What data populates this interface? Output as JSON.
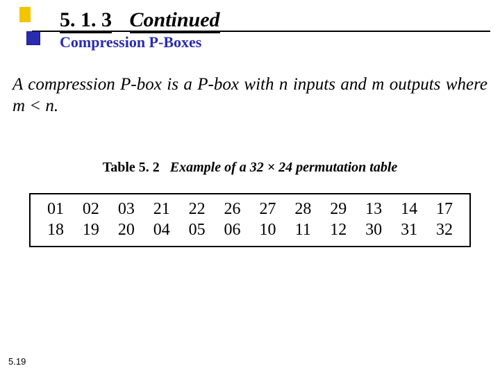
{
  "header": {
    "section_number": "5. 1. 3",
    "continued_label": "Continued",
    "subtitle": "Compression P-Boxes"
  },
  "body": {
    "text": "A compression P-box is a P-box with n inputs and m outputs where m < n."
  },
  "caption": {
    "prefix": "Table  5. 2",
    "desc": "Example of a 32 × 24 permutation table"
  },
  "chart_data": {
    "type": "table",
    "title": "Example of a 32 × 24 permutation table",
    "rows": [
      [
        "01",
        "02",
        "03",
        "21",
        "22",
        "26",
        "27",
        "28",
        "29",
        "13",
        "14",
        "17"
      ],
      [
        "18",
        "19",
        "20",
        "04",
        "05",
        "06",
        "10",
        "11",
        "12",
        "30",
        "31",
        "32"
      ]
    ]
  },
  "page_number": "5.19"
}
